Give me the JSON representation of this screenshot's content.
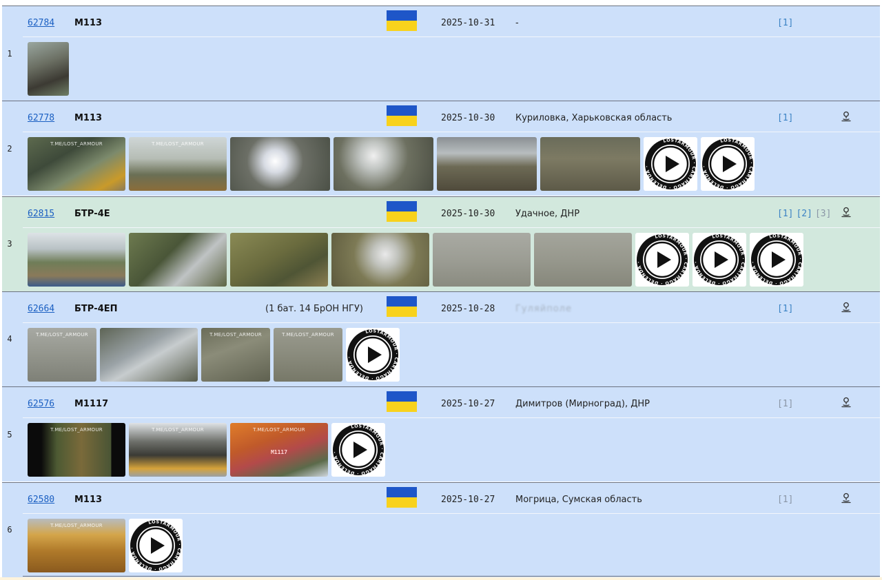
{
  "flag_colors": {
    "blue": "#1e56c8",
    "yellow": "#f8d21c"
  },
  "video": {
    "badge_top": "LOSTARMOUR",
    "badge_right": "CARTHAGO",
    "badge_bottom": "DELENDA",
    "badge_left": "EST"
  },
  "watermark": "T.ME/LOST_ARMOUR",
  "entries": [
    {
      "num": "1",
      "id": "62784",
      "model": "M113",
      "unit": "",
      "date": "2025-10-31",
      "location": "-",
      "location_blurred": false,
      "sources": [
        {
          "label": "[1]",
          "active": true
        }
      ],
      "geo": false,
      "thumbs": [
        {
          "w": 60,
          "bg": "linear-gradient(160deg,#9aa7a0 0%,#6b6f63 40%,#3c3a33 70%,#6f7f66 100%)",
          "wm": false
        }
      ],
      "videos": 0,
      "alt": false
    },
    {
      "num": "2",
      "id": "62778",
      "model": "M113",
      "unit": "",
      "date": "2025-10-30",
      "location": "Куриловка, Харьковская область",
      "location_blurred": false,
      "sources": [
        {
          "label": "[1]",
          "active": true
        }
      ],
      "geo": true,
      "thumbs": [
        {
          "w": 142,
          "bg": "linear-gradient(150deg,#5d6a4e 0%,#3e4a3a 35%,#7c8a6c 60%,#c99a2a 85%,#8a7a5a 100%)",
          "wm": true
        },
        {
          "w": 142,
          "bg": "linear-gradient(180deg,#cfd6d6 0%,#b6bdb5 40%,#6a6f55 70%,#8b6d3a 100%)",
          "wm": true
        },
        {
          "w": 145,
          "bg": "radial-gradient(circle at 45% 45%,#ffffff 0%,#d7dbe3 18%,#6c6f66 45%,#4b5046 100%)",
          "wm": false
        },
        {
          "w": 145,
          "bg": "radial-gradient(circle at 40% 35%,#f0f0f0 0%,#bfc3c0 20%,#6d7060 50%,#4a4d42 100%)",
          "wm": false
        },
        {
          "w": 145,
          "bg": "linear-gradient(180deg,#8a8f93 0%,#b8bdbf 30%,#6d6a55 55%,#4f4a3b 100%)",
          "wm": false
        },
        {
          "w": 145,
          "bg": "linear-gradient(180deg,#6a6c5a 0%,#7d7a63 40%,#5d5a48 100%)",
          "wm": false
        }
      ],
      "videos": 2,
      "alt": false
    },
    {
      "num": "3",
      "id": "62815",
      "model": "БТР-4Е",
      "unit": "",
      "date": "2025-10-30",
      "location": "Удачное, ДНР",
      "location_blurred": false,
      "sources": [
        {
          "label": "[1]",
          "active": true
        },
        {
          "label": "[2]",
          "active": true
        },
        {
          "label": "[3]",
          "active": false
        }
      ],
      "geo": true,
      "thumbs": [
        {
          "w": 142,
          "bg": "linear-gradient(180deg,#dde3e6 0%,#b9c2c5 30%,#6f7d58 55%,#8a7a5a 80%,#3c5b8a 100%)",
          "wm": false
        },
        {
          "w": 142,
          "bg": "linear-gradient(135deg,#6d7a4f 0%,#4a5638 40%,#bfc3c4 65%,#5d6544 100%)",
          "wm": false
        },
        {
          "w": 142,
          "bg": "linear-gradient(150deg,#8a8a55 0%,#6a6b3e 45%,#4f5535 70%,#8b7f52 100%)",
          "wm": false
        },
        {
          "w": 142,
          "bg": "radial-gradient(circle at 55% 40%,#e9e9ea 0%,#c1c3bd 20%,#7d7a55 50%,#5d5a3d 100%)",
          "wm": false
        },
        {
          "w": 142,
          "bg": "linear-gradient(180deg,#a9aaa3 0%,#9c9d94 50%,#8a8b80 100%)",
          "wm": false
        },
        {
          "w": 142,
          "bg": "linear-gradient(180deg,#a4a59c 0%,#97988d 50%,#86877b 100%)",
          "wm": false
        }
      ],
      "videos": 3,
      "alt": true
    },
    {
      "num": "4",
      "id": "62664",
      "model": "БТР-4ЕП",
      "unit": "(1 бат. 14 БрОН НГУ)",
      "date": "2025-10-28",
      "location": "Гуляйполе",
      "location_blurred": true,
      "sources": [
        {
          "label": "[1]",
          "active": true
        }
      ],
      "geo": true,
      "thumbs": [
        {
          "w": 100,
          "bg": "linear-gradient(180deg,#a7a9a3 0%,#93958c 50%,#7e8077 100%)",
          "wm": true
        },
        {
          "w": 142,
          "bg": "linear-gradient(150deg,#5d6455 0%,#9aa2a6 40%,#c7ccce 55%,#585d4c 100%)",
          "wm": false
        },
        {
          "w": 100,
          "bg": "linear-gradient(160deg,#6a6c58 0%,#8b8c79 40%,#5f6150 100%)",
          "wm": true
        },
        {
          "w": 100,
          "bg": "linear-gradient(180deg,#9a9b8f 0%,#8a8b7d 50%,#777868 100%)",
          "wm": true
        }
      ],
      "videos": 1,
      "alt": false
    },
    {
      "num": "5",
      "id": "62576",
      "model": "M1117",
      "unit": "",
      "date": "2025-10-27",
      "location": "Димитров (Мирноград), ДНР",
      "location_blurred": false,
      "sources": [
        {
          "label": "[1]",
          "active": false
        }
      ],
      "geo": true,
      "thumbs": [
        {
          "w": 142,
          "bg": "linear-gradient(90deg,#0b0b0b 0%,#0b0b0b 14%,#4d5a33 30%,#7a6a3a 55%,#4a5535 85%,#0b0b0b 86%,#0b0b0b 100%)",
          "wm": true
        },
        {
          "w": 142,
          "bg": "linear-gradient(180deg,#dfe3e6 0%,#6d6f6a 35%,#3a3a35 60%,#d6a33a 85%,#9aa0a5 100%)",
          "wm": true
        },
        {
          "w": 142,
          "bg": "linear-gradient(160deg,#e07d2a 0%,#c05a2a 35%,#b34a4a 55%,#5b6a4a 80%,#cfd6dd 100%)",
          "wm": true,
          "tag": "M1117"
        }
      ],
      "videos": 1,
      "alt": false
    },
    {
      "num": "6",
      "id": "62580",
      "model": "M113",
      "unit": "",
      "date": "2025-10-27",
      "location": "Могрица, Сумская область",
      "location_blurred": false,
      "sources": [
        {
          "label": "[1]",
          "active": false
        }
      ],
      "geo": true,
      "thumbs": [
        {
          "w": 142,
          "bg": "linear-gradient(180deg,#b7bcbf 0%,#d4a54a 30%,#b07a2a 60%,#8a5a1e 100%)",
          "wm": true
        }
      ],
      "videos": 1,
      "alt": false
    }
  ]
}
